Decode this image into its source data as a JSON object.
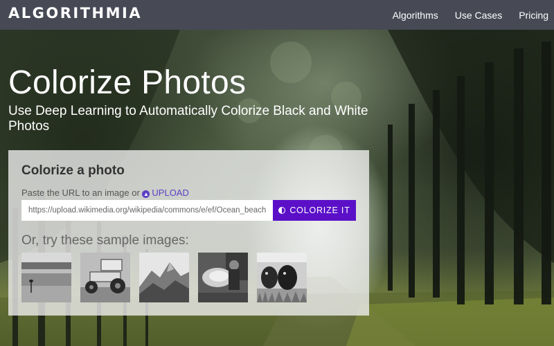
{
  "navbar": {
    "brand": "ALGORITHMIA",
    "links": [
      "Algorithms",
      "Use Cases",
      "Pricing"
    ]
  },
  "hero": {
    "title": "Colorize Photos",
    "subtitle": "Use Deep Learning to Automatically Colorize Black and White Photos"
  },
  "card": {
    "title": "Colorize a photo",
    "url_prompt": "Paste the URL to an image or",
    "upload_label": "UPLOAD",
    "upload_icon": "upload-icon",
    "url_value": "https://upload.wikimedia.org/wikipedia/commons/e/ef/Ocean_beach",
    "button_label": "COLORIZE IT",
    "button_icon": "contrast-icon",
    "samples_heading": "Or, try these sample images:",
    "sample_images": [
      "bird-on-beach",
      "sprint-car",
      "mountain-rock",
      "man-with-animal",
      "cattle"
    ]
  },
  "colors": {
    "navbar_bg": "#474a55",
    "accent": "#5b10c8",
    "link": "#5b3fc4",
    "card_bg": "rgba(238,238,238,0.80)"
  }
}
